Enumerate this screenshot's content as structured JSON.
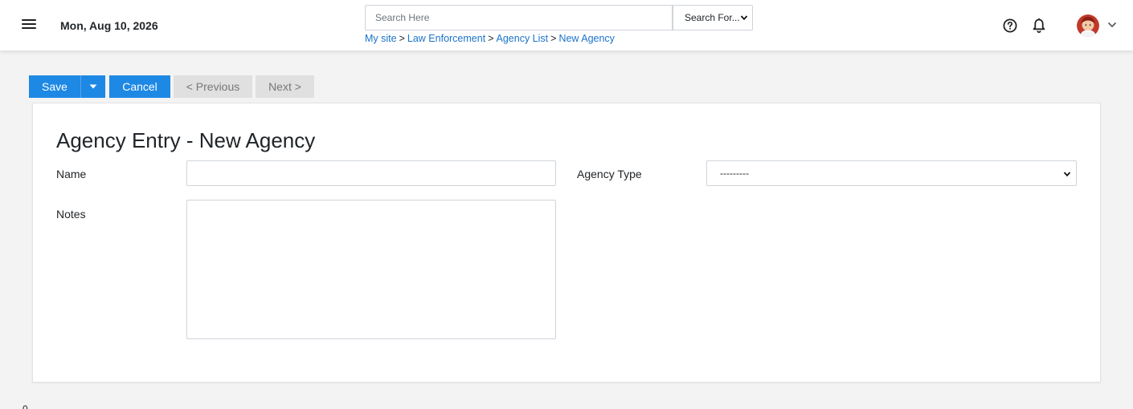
{
  "header": {
    "date": "Mon, Aug 10, 2026",
    "search": {
      "placeholder": "Search Here",
      "value": ""
    },
    "search_scope": {
      "selected": "Search For..."
    },
    "breadcrumb": [
      "My site",
      "Law Enforcement",
      "Agency List",
      "New Agency"
    ],
    "breadcrumb_separator": ">"
  },
  "toolbar": {
    "save_label": "Save",
    "cancel_label": "Cancel",
    "previous_label": "< Previous",
    "next_label": "Next >"
  },
  "form": {
    "title": "Agency Entry - New Agency",
    "name_label": "Name",
    "name_value": "",
    "notes_label": "Notes",
    "notes_value": "",
    "agency_type_label": "Agency Type",
    "agency_type_selected": "---------"
  },
  "footer": {
    "corner_text": "0"
  },
  "colors": {
    "primary": "#1e88e5",
    "link": "#1a73c9",
    "disabled": "#e0e0e0",
    "background": "#f3f3f3"
  },
  "icons": [
    "menu-icon",
    "dropdown-chevron-icon",
    "help-icon",
    "bell-icon",
    "user-avatar",
    "caret-down-icon"
  ]
}
